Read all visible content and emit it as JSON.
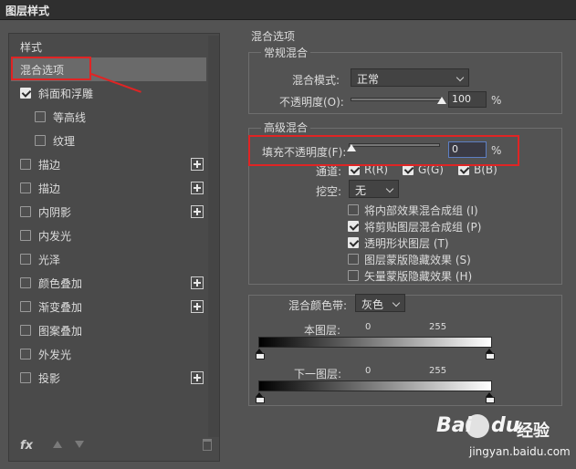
{
  "window": {
    "title": "图层样式"
  },
  "left": {
    "header": "样式",
    "items": [
      {
        "label": "混合选项",
        "checkbox": false,
        "checked": false,
        "plus": false,
        "selected": true
      },
      {
        "label": "斜面和浮雕",
        "checkbox": true,
        "checked": true,
        "plus": false,
        "selected": false
      },
      {
        "label": "等高线",
        "checkbox": true,
        "checked": false,
        "plus": false,
        "selected": false,
        "indent": true
      },
      {
        "label": "纹理",
        "checkbox": true,
        "checked": false,
        "plus": false,
        "selected": false,
        "indent": true
      },
      {
        "label": "描边",
        "checkbox": true,
        "checked": false,
        "plus": true,
        "selected": false
      },
      {
        "label": "描边",
        "checkbox": true,
        "checked": false,
        "plus": true,
        "selected": false
      },
      {
        "label": "内阴影",
        "checkbox": true,
        "checked": false,
        "plus": true,
        "selected": false
      },
      {
        "label": "内发光",
        "checkbox": true,
        "checked": false,
        "plus": false,
        "selected": false
      },
      {
        "label": "光泽",
        "checkbox": true,
        "checked": false,
        "plus": false,
        "selected": false
      },
      {
        "label": "颜色叠加",
        "checkbox": true,
        "checked": false,
        "plus": true,
        "selected": false
      },
      {
        "label": "渐变叠加",
        "checkbox": true,
        "checked": false,
        "plus": true,
        "selected": false
      },
      {
        "label": "图案叠加",
        "checkbox": true,
        "checked": false,
        "plus": false,
        "selected": false
      },
      {
        "label": "外发光",
        "checkbox": true,
        "checked": false,
        "plus": false,
        "selected": false
      },
      {
        "label": "投影",
        "checkbox": true,
        "checked": false,
        "plus": true,
        "selected": false
      }
    ],
    "footer": {
      "fx_label": "fx"
    }
  },
  "right": {
    "section_title": "混合选项",
    "general": {
      "title": "常规混合",
      "blend_mode_label": "混合模式:",
      "blend_mode_value": "正常",
      "opacity_label": "不透明度(O):",
      "opacity_value": "100",
      "opacity_pct": 100,
      "percent": "%"
    },
    "advanced": {
      "title": "高级混合",
      "fill_opacity_label": "填充不透明度(F):",
      "fill_opacity_value": "0",
      "fill_opacity_pct": 0,
      "percent": "%",
      "channels_label": "通道:",
      "channels": [
        {
          "label": "R(R)",
          "checked": true
        },
        {
          "label": "G(G)",
          "checked": true
        },
        {
          "label": "B(B)",
          "checked": true
        }
      ],
      "knockout_label": "挖空:",
      "knockout_value": "无",
      "options": [
        {
          "label": "将内部效果混合成组 (I)",
          "checked": false
        },
        {
          "label": "将剪贴图层混合成组 (P)",
          "checked": true
        },
        {
          "label": "透明形状图层 (T)",
          "checked": true
        },
        {
          "label": "图层蒙版隐藏效果 (S)",
          "checked": false
        },
        {
          "label": "矢量蒙版隐藏效果 (H)",
          "checked": false
        }
      ]
    },
    "blend_if": {
      "label": "混合颜色带:",
      "value": "灰色",
      "this_layer_label": "本图层:",
      "this_layer_min": "0",
      "this_layer_max": "255",
      "underlying_label": "下一图层:",
      "underlying_min": "0",
      "underlying_max": "255"
    }
  },
  "watermark": {
    "bai": "Bai",
    "du": "du",
    "jy": "经验",
    "url": "jingyan.baidu.com"
  },
  "colors": {
    "highlight": "#e02424",
    "panel_bg": "#535353",
    "selected_bg": "#6a6a6a"
  },
  "icons": [
    "plus-icon",
    "checkbox-icon",
    "chevron-down-icon",
    "arrow-up-icon",
    "arrow-down-icon",
    "trash-icon",
    "fx-icon",
    "slider-thumb-icon"
  ]
}
